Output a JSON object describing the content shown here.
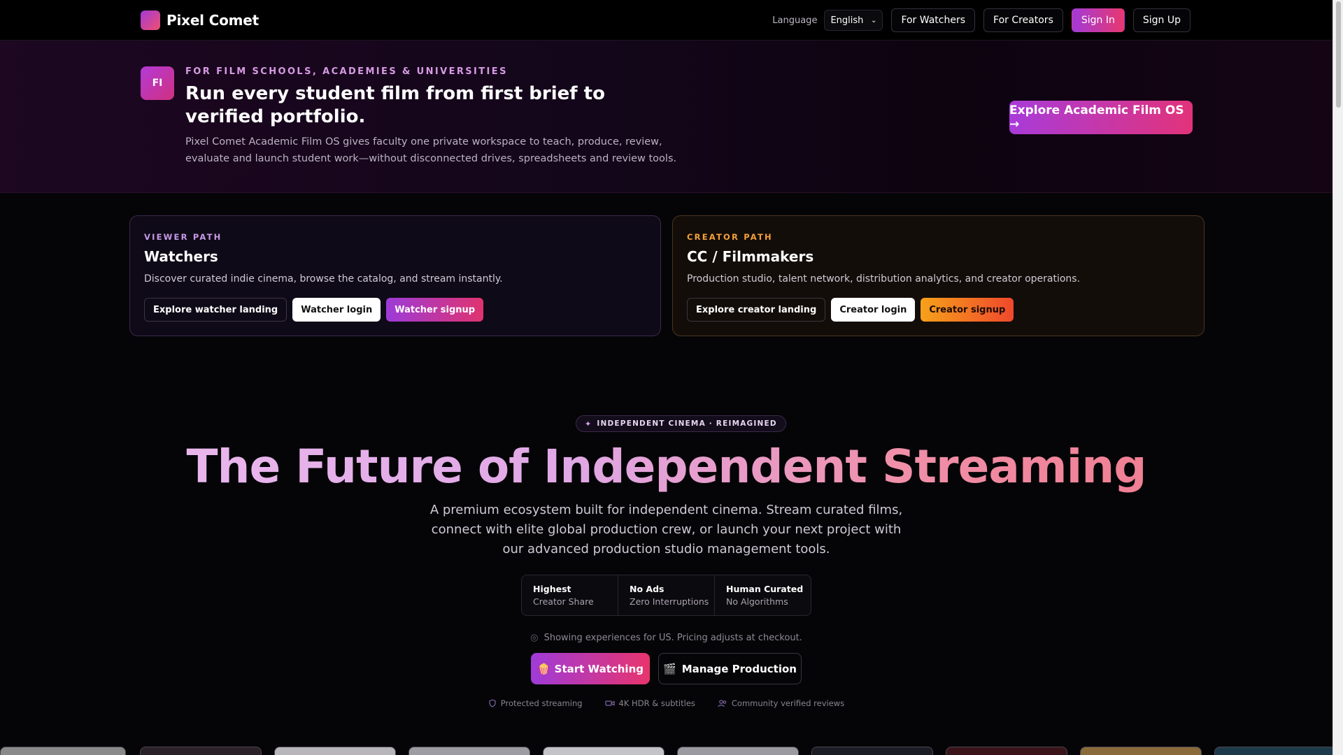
{
  "nav": {
    "brand": "Pixel Comet",
    "language_label": "Language",
    "language_value": "English",
    "for_watchers": "For Watchers",
    "for_creators": "For Creators",
    "sign_in": "Sign In",
    "sign_up": "Sign Up"
  },
  "banner": {
    "badge": "FI",
    "eyebrow": "FOR FILM SCHOOLS, ACADEMIES & UNIVERSITIES",
    "title": "Run every student film from first brief to verified portfolio.",
    "description": "Pixel Comet Academic Film OS gives faculty one private workspace to teach, produce, review, evaluate and launch student work—without disconnected drives, spreadsheets and review tools.",
    "cta": "Explore Academic Film OS →"
  },
  "viewer_card": {
    "eyebrow": "VIEWER PATH",
    "title": "Watchers",
    "description": "Discover curated indie cinema, browse the catalog, and stream instantly.",
    "landing": "Explore watcher landing",
    "login": "Watcher login",
    "signup": "Watcher signup"
  },
  "creator_card": {
    "eyebrow": "CREATOR PATH",
    "title": "CC / Filmmakers",
    "description": "Production studio, talent network, distribution analytics, and creator operations.",
    "landing": "Explore creator landing",
    "login": "Creator login",
    "signup": "Creator signup"
  },
  "hero": {
    "badge": "INDEPENDENT CINEMA · REIMAGINED",
    "title": "The Future of Independent Streaming",
    "subtitle": "A premium ecosystem built for independent cinema. Stream curated films, connect with elite global production crew, or launch your next project with our advanced production studio management tools.",
    "stats": [
      {
        "title": "Highest",
        "sub": "Creator Share"
      },
      {
        "title": "No Ads",
        "sub": "Zero Interruptions"
      },
      {
        "title": "Human Curated",
        "sub": "No Algorithms"
      }
    ],
    "geo_note": "Showing experiences for US. Pricing adjusts at checkout.",
    "start_watching": "Start Watching",
    "manage_production": "Manage Production",
    "trust": [
      "Protected streaming",
      "4K HDR & subtitles",
      "Community verified reviews"
    ]
  },
  "colors": {
    "accent_purple": "#a23ad8",
    "accent_pink": "#e8386f",
    "creator_orange": "#f4a13b"
  },
  "icons": {
    "sparkle": "sparkle-icon",
    "pin": "location-pin-icon",
    "popcorn": "popcorn-icon",
    "clapper": "clapperboard-icon",
    "shield": "shield-icon",
    "video": "video-camera-icon",
    "users": "users-icon"
  }
}
